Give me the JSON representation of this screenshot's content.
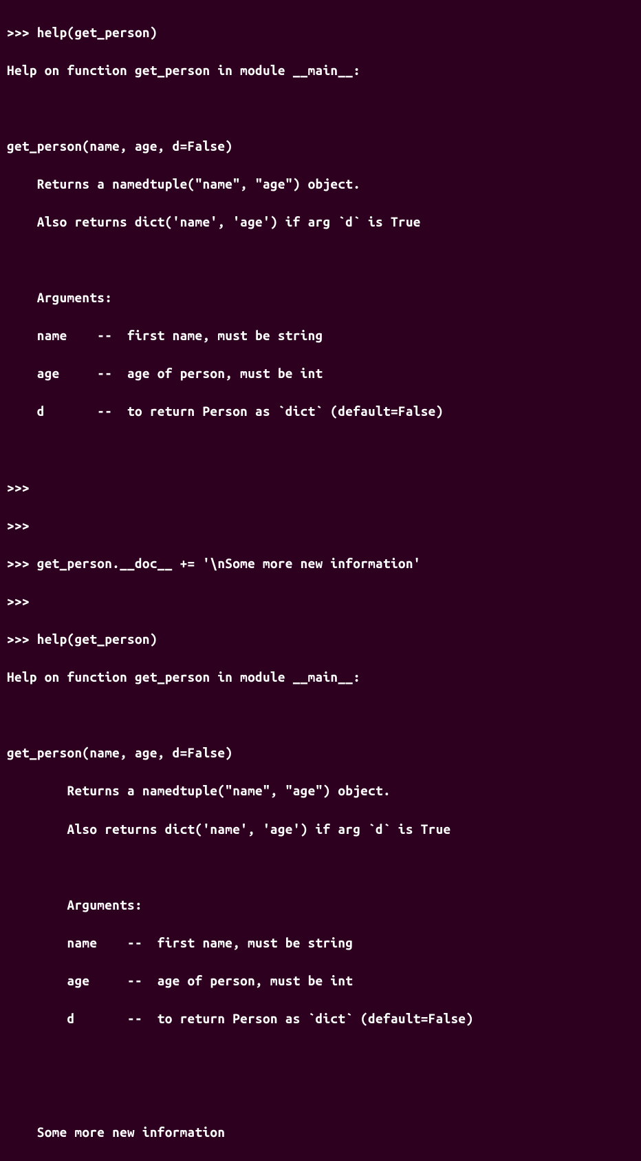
{
  "terminal": {
    "lines": [
      ">>> help(get_person)",
      "Help on function get_person in module __main__:",
      "",
      "get_person(name, age, d=False)",
      "    Returns a namedtuple(\"name\", \"age\") object.",
      "    Also returns dict('name', 'age') if arg `d` is True",
      "",
      "    Arguments:",
      "    name    --  first name, must be string",
      "    age     --  age of person, must be int",
      "    d       --  to return Person as `dict` (default=False)",
      "",
      ">>> ",
      ">>> ",
      ">>> get_person.__doc__ += '\\nSome more new information'",
      ">>> ",
      ">>> help(get_person)",
      "Help on function get_person in module __main__:",
      "",
      "get_person(name, age, d=False)",
      "        Returns a namedtuple(\"name\", \"age\") object.",
      "        Also returns dict('name', 'age') if arg `d` is True",
      "",
      "        Arguments:",
      "        name    --  first name, must be string",
      "        age     --  age of person, must be int",
      "        d       --  to return Person as `dict` (default=False)",
      "",
      "",
      "    Some more new information"
    ]
  }
}
